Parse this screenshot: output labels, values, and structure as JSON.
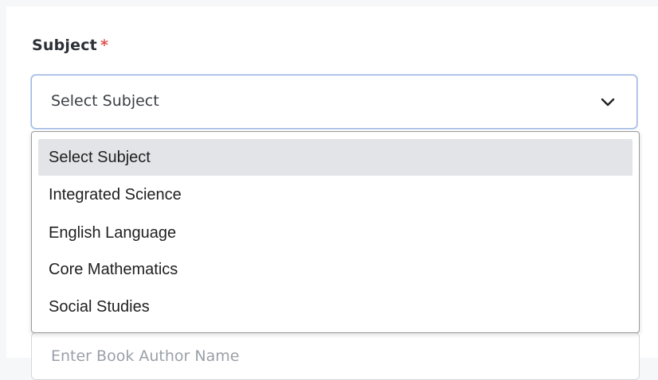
{
  "subject_field": {
    "label": "Subject",
    "required_marker": "*",
    "selected_value": "Select Subject",
    "chevron_icon": "chevron-down-icon"
  },
  "dropdown": {
    "options": [
      {
        "label": "Select Subject",
        "highlighted": true
      },
      {
        "label": "Integrated Science",
        "highlighted": false
      },
      {
        "label": "English Language",
        "highlighted": false
      },
      {
        "label": "Core Mathematics",
        "highlighted": false
      },
      {
        "label": "Social Studies",
        "highlighted": false
      }
    ]
  },
  "author_field": {
    "placeholder": "Enter Book Author Name"
  },
  "colors": {
    "required": "#e0554f",
    "focus_border": "#9cb6e3",
    "highlight_bg": "#e3e4e8"
  }
}
